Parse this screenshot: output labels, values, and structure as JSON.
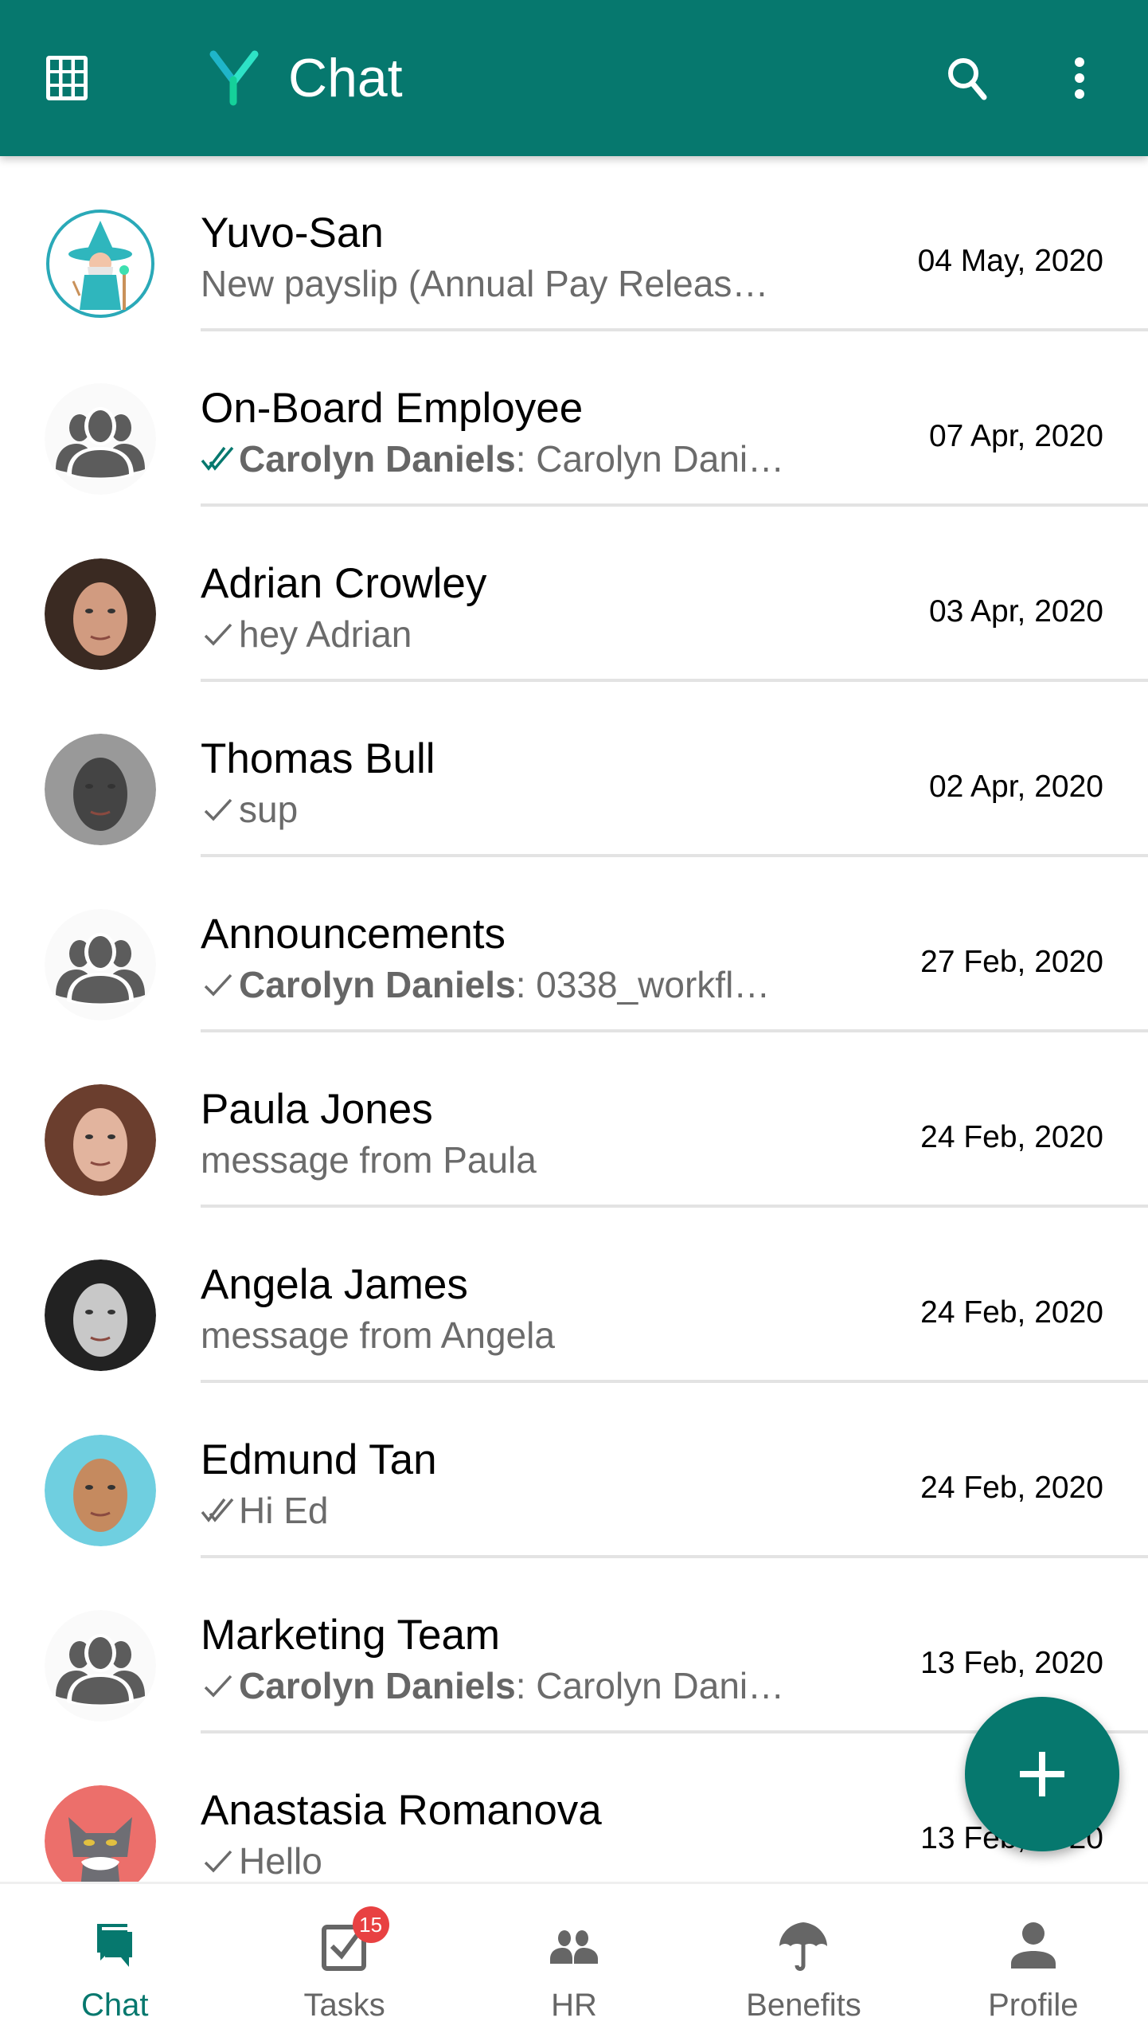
{
  "app": {
    "title": "Chat",
    "accent_color": "#06786e",
    "icons": {
      "menu": "grid-icon",
      "logo": "yuvo-logo-icon",
      "search": "search-icon",
      "more": "more-vertical-icon",
      "fab": "plus-icon"
    }
  },
  "chats": [
    {
      "name": "Yuvo-San",
      "status": "",
      "sender": "",
      "message": "New payslip (Annual Pay Releas…",
      "date": "04 May, 2020",
      "avatar": "wizard"
    },
    {
      "name": "On-Board Employee",
      "status": "read",
      "sender": "Carolyn Daniels",
      "separator": ": ",
      "message": "Carolyn Dani…",
      "date": "07 Apr, 2020",
      "avatar": "group"
    },
    {
      "name": "Adrian Crowley",
      "status": "sent",
      "sender": "",
      "message": "hey Adrian",
      "date": "03 Apr, 2020",
      "avatar": "photo"
    },
    {
      "name": "Thomas Bull",
      "status": "sent",
      "sender": "",
      "message": "sup",
      "date": "02 Apr, 2020",
      "avatar": "photo"
    },
    {
      "name": "Announcements",
      "status": "sent",
      "sender": "Carolyn Daniels",
      "separator": ": ",
      "message": "0338_workfl…",
      "date": "27 Feb, 2020",
      "avatar": "group"
    },
    {
      "name": "Paula Jones",
      "status": "",
      "sender": "",
      "message": "message from Paula",
      "date": "24 Feb, 2020",
      "avatar": "photo"
    },
    {
      "name": "Angela James",
      "status": "",
      "sender": "",
      "message": "message from Angela",
      "date": "24 Feb, 2020",
      "avatar": "photo"
    },
    {
      "name": "Edmund Tan",
      "status": "delivered",
      "sender": "",
      "message": "Hi Ed",
      "date": "24 Feb, 2020",
      "avatar": "photo"
    },
    {
      "name": "Marketing Team",
      "status": "sent",
      "sender": "Carolyn Daniels",
      "separator": ": ",
      "message": "Carolyn Dani…",
      "date": "13 Feb, 2020",
      "avatar": "group"
    },
    {
      "name": "Anastasia Romanova",
      "status": "sent",
      "sender": "",
      "message": "Hello",
      "date": "13 Feb, 2020",
      "avatar": "cartoon"
    }
  ],
  "bottom_nav": [
    {
      "label": "Chat",
      "icon": "chat-icon",
      "active": true
    },
    {
      "label": "Tasks",
      "icon": "tasks-icon",
      "badge": "15"
    },
    {
      "label": "HR",
      "icon": "people-icon"
    },
    {
      "label": "Benefits",
      "icon": "umbrella-icon"
    },
    {
      "label": "Profile",
      "icon": "person-icon"
    }
  ]
}
